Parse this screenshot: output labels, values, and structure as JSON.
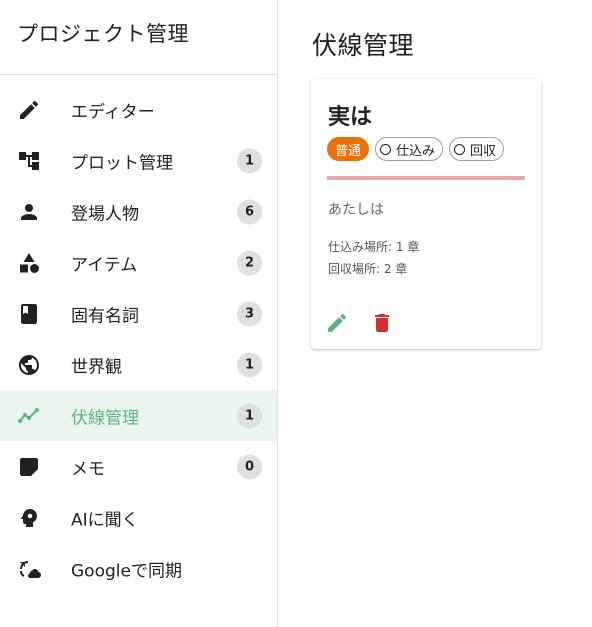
{
  "sidebar": {
    "title": "プロジェクト管理",
    "items": [
      {
        "label": "エディター",
        "icon": "pencil-icon",
        "badge": ""
      },
      {
        "label": "プロット管理",
        "icon": "hierarchy-icon",
        "badge": "1"
      },
      {
        "label": "登場人物",
        "icon": "person-icon",
        "badge": "6"
      },
      {
        "label": "アイテム",
        "icon": "shapes-icon",
        "badge": "2"
      },
      {
        "label": "固有名詞",
        "icon": "book-icon",
        "badge": "3"
      },
      {
        "label": "世界観",
        "icon": "globe-icon",
        "badge": "1"
      },
      {
        "label": "伏線管理",
        "icon": "timeline-icon",
        "badge": "1",
        "active": true
      },
      {
        "label": "メモ",
        "icon": "note-icon",
        "badge": "0"
      },
      {
        "label": "AIに聞く",
        "icon": "brain-head-icon",
        "badge": ""
      },
      {
        "label": "Googleで同期",
        "icon": "cloud-sync-icon",
        "badge": ""
      }
    ]
  },
  "main": {
    "title": "伏線管理",
    "card": {
      "title": "実は",
      "chips": {
        "importance": "普通",
        "setup": "仕込み",
        "payoff": "回収"
      },
      "body": "あたしは",
      "setup_place": "仕込み場所: 1 章",
      "payoff_place": "回収場所: 2 章"
    }
  },
  "colors": {
    "accent": "#5fb383",
    "active_bg": "#e9f5ee",
    "importance_chip": "#e8710a",
    "divider_line": "#e8a8a8",
    "edit_icon": "#5fb383",
    "delete_icon": "#d32f2f"
  }
}
